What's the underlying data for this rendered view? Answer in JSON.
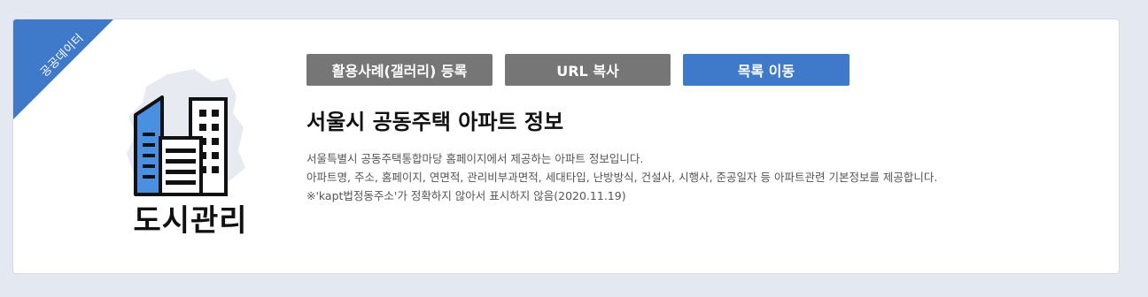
{
  "badge": "공공데이터",
  "category": "도시관리",
  "buttons": {
    "gallery": "활용사례(갤러리) 등록",
    "copy_url": "URL 복사",
    "to_list": "목록 이동"
  },
  "title": "서울시 공동주택 아파트 정보",
  "description": [
    "서울특별시 공동주택통합마당 홈페이지에서 제공하는 아파트 정보입니다.",
    "아파트명, 주소, 홈페이지, 연면적, 관리비부과면적, 세대타입, 난방방식, 건설사, 시행사, 준공일자 등 아파트관련 기본정보를 제공합니다.",
    "※'kapt법정동주소'가 정확하지 않아서 표시하지 않음(2020.11.19)"
  ],
  "colors": {
    "accent": "#3f79c9",
    "button_gray": "#767676",
    "background": "#e4e9f1"
  },
  "icons": {
    "illustration": "city-buildings-icon"
  }
}
